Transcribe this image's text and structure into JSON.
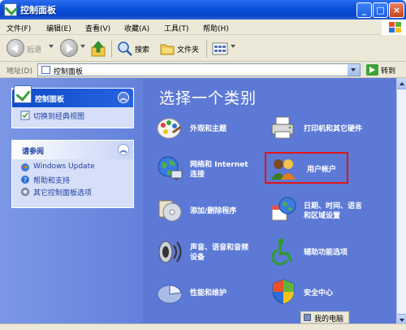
{
  "window": {
    "title": "控制面板"
  },
  "menu": [
    "文件(F)",
    "编辑(E)",
    "查看(V)",
    "收藏(A)",
    "工具(T)",
    "帮助(H)"
  ],
  "toolbar": {
    "back": "后退",
    "search": "搜索",
    "folders": "文件夹"
  },
  "address": {
    "label": "地址(D)",
    "value": "控制面板",
    "go": "转到"
  },
  "sidebar": {
    "panel_title": "控制面板",
    "switch_link": "切换到经典视图",
    "see_also_title": "请参阅",
    "see_also": [
      "Windows Update",
      "帮助和支持",
      "其它控制面板选项"
    ]
  },
  "main": {
    "heading": "选择一个类别",
    "categories": [
      [
        "外观和主题"
      ],
      [
        "打印机和其它硬件"
      ],
      [
        "网络和 Internet",
        "连接"
      ],
      [
        "用户帐户"
      ],
      [
        "添加/删除程序"
      ],
      [
        "日期、时间、语言",
        "和区域设置"
      ],
      [
        "声音、语音和音频",
        "设备"
      ],
      [
        "辅助功能选项"
      ],
      [
        "性能和维护"
      ],
      [
        "安全中心"
      ]
    ]
  },
  "status": {
    "text": "我的电脑"
  },
  "colors": {
    "highlight": "#e01616",
    "pane_bg": "#5c79d6",
    "title_bar": "#0a4fd9"
  }
}
